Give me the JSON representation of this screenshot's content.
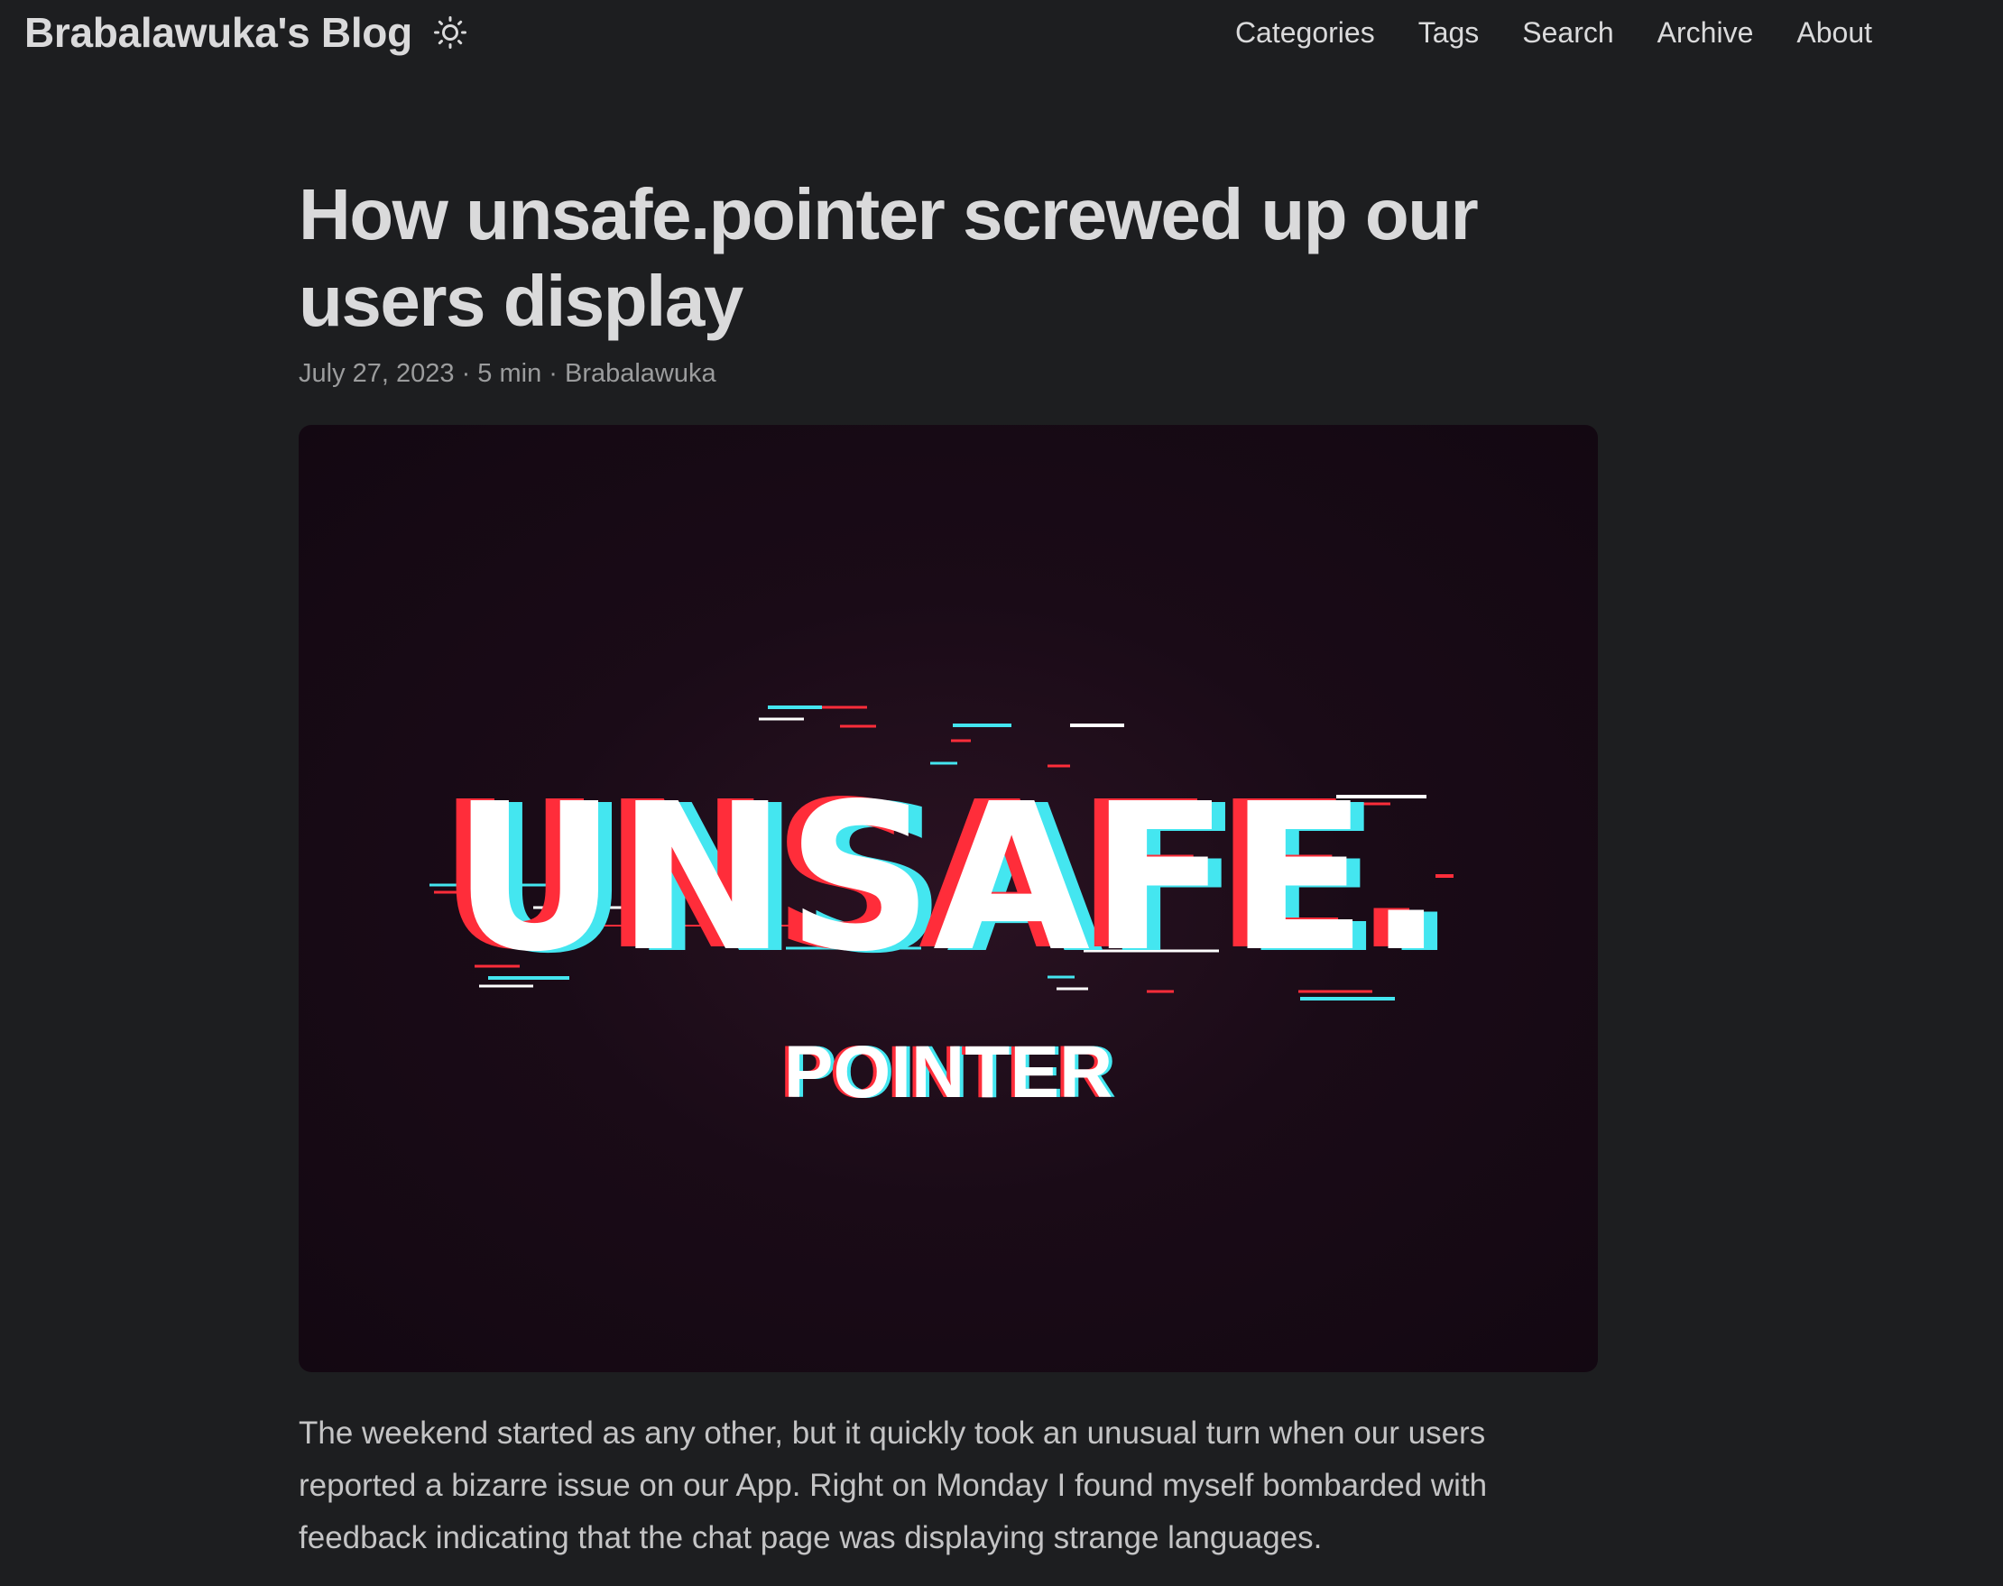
{
  "header": {
    "brand": "Brabalawuka's Blog",
    "theme_icon": "sun-icon",
    "nav": [
      "Categories",
      "Tags",
      "Search",
      "Archive",
      "About"
    ]
  },
  "post": {
    "title": "How unsafe.pointer screwed up our users display",
    "meta": "July 27, 2023 · 5 min · Brabalawuka",
    "cover": {
      "headline": "UNSAFE.",
      "subline": "POINTER"
    },
    "paragraph": "The weekend started as any other, but it quickly took an unusual turn when our users reported a bizarre issue on our App. Right on Monday I found myself bombarded with feedback indicating that the chat page was displaying strange languages."
  },
  "colors": {
    "background": "#1d1e20",
    "text": "#dadadb",
    "meta": "#9b9c9d",
    "glitch_red": "#ff2d3a",
    "glitch_cyan": "#44e6f0"
  }
}
